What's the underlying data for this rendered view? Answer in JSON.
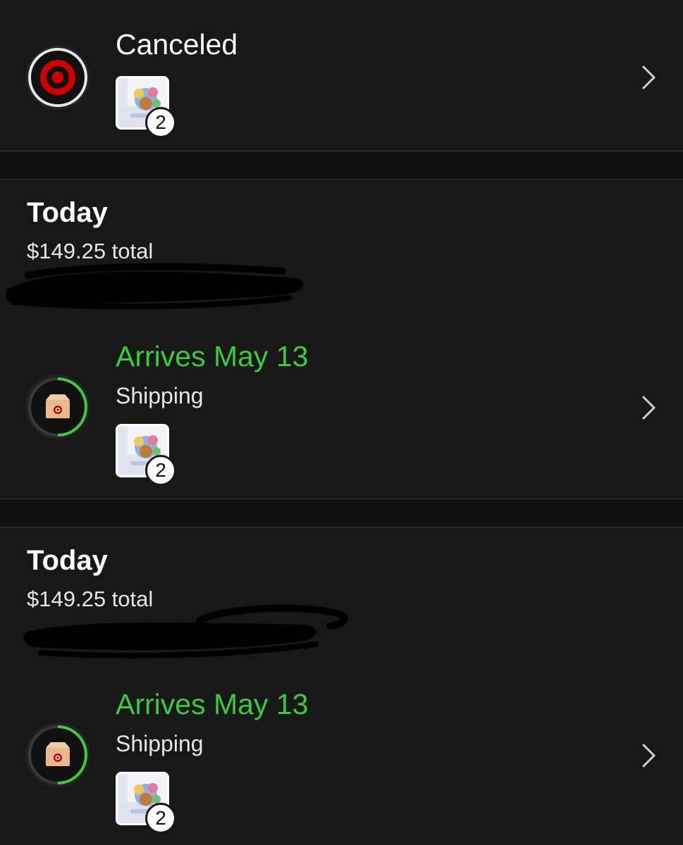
{
  "colors": {
    "background": "#181818",
    "separator": "#111111",
    "accent_green": "#3fc93f",
    "target_red": "#cc0000"
  },
  "canceled_order": {
    "status": "Canceled",
    "icon": "target-logo-icon",
    "item_count": "2"
  },
  "orders": [
    {
      "date": "Today",
      "total": "$149.25 total",
      "arrival": "Arrives May 13",
      "status": "Shipping",
      "icon": "shipping-box-icon",
      "item_count": "2"
    },
    {
      "date": "Today",
      "total": "$149.25 total",
      "arrival": "Arrives May 13",
      "status": "Shipping",
      "icon": "shipping-box-icon",
      "item_count": "2"
    }
  ]
}
